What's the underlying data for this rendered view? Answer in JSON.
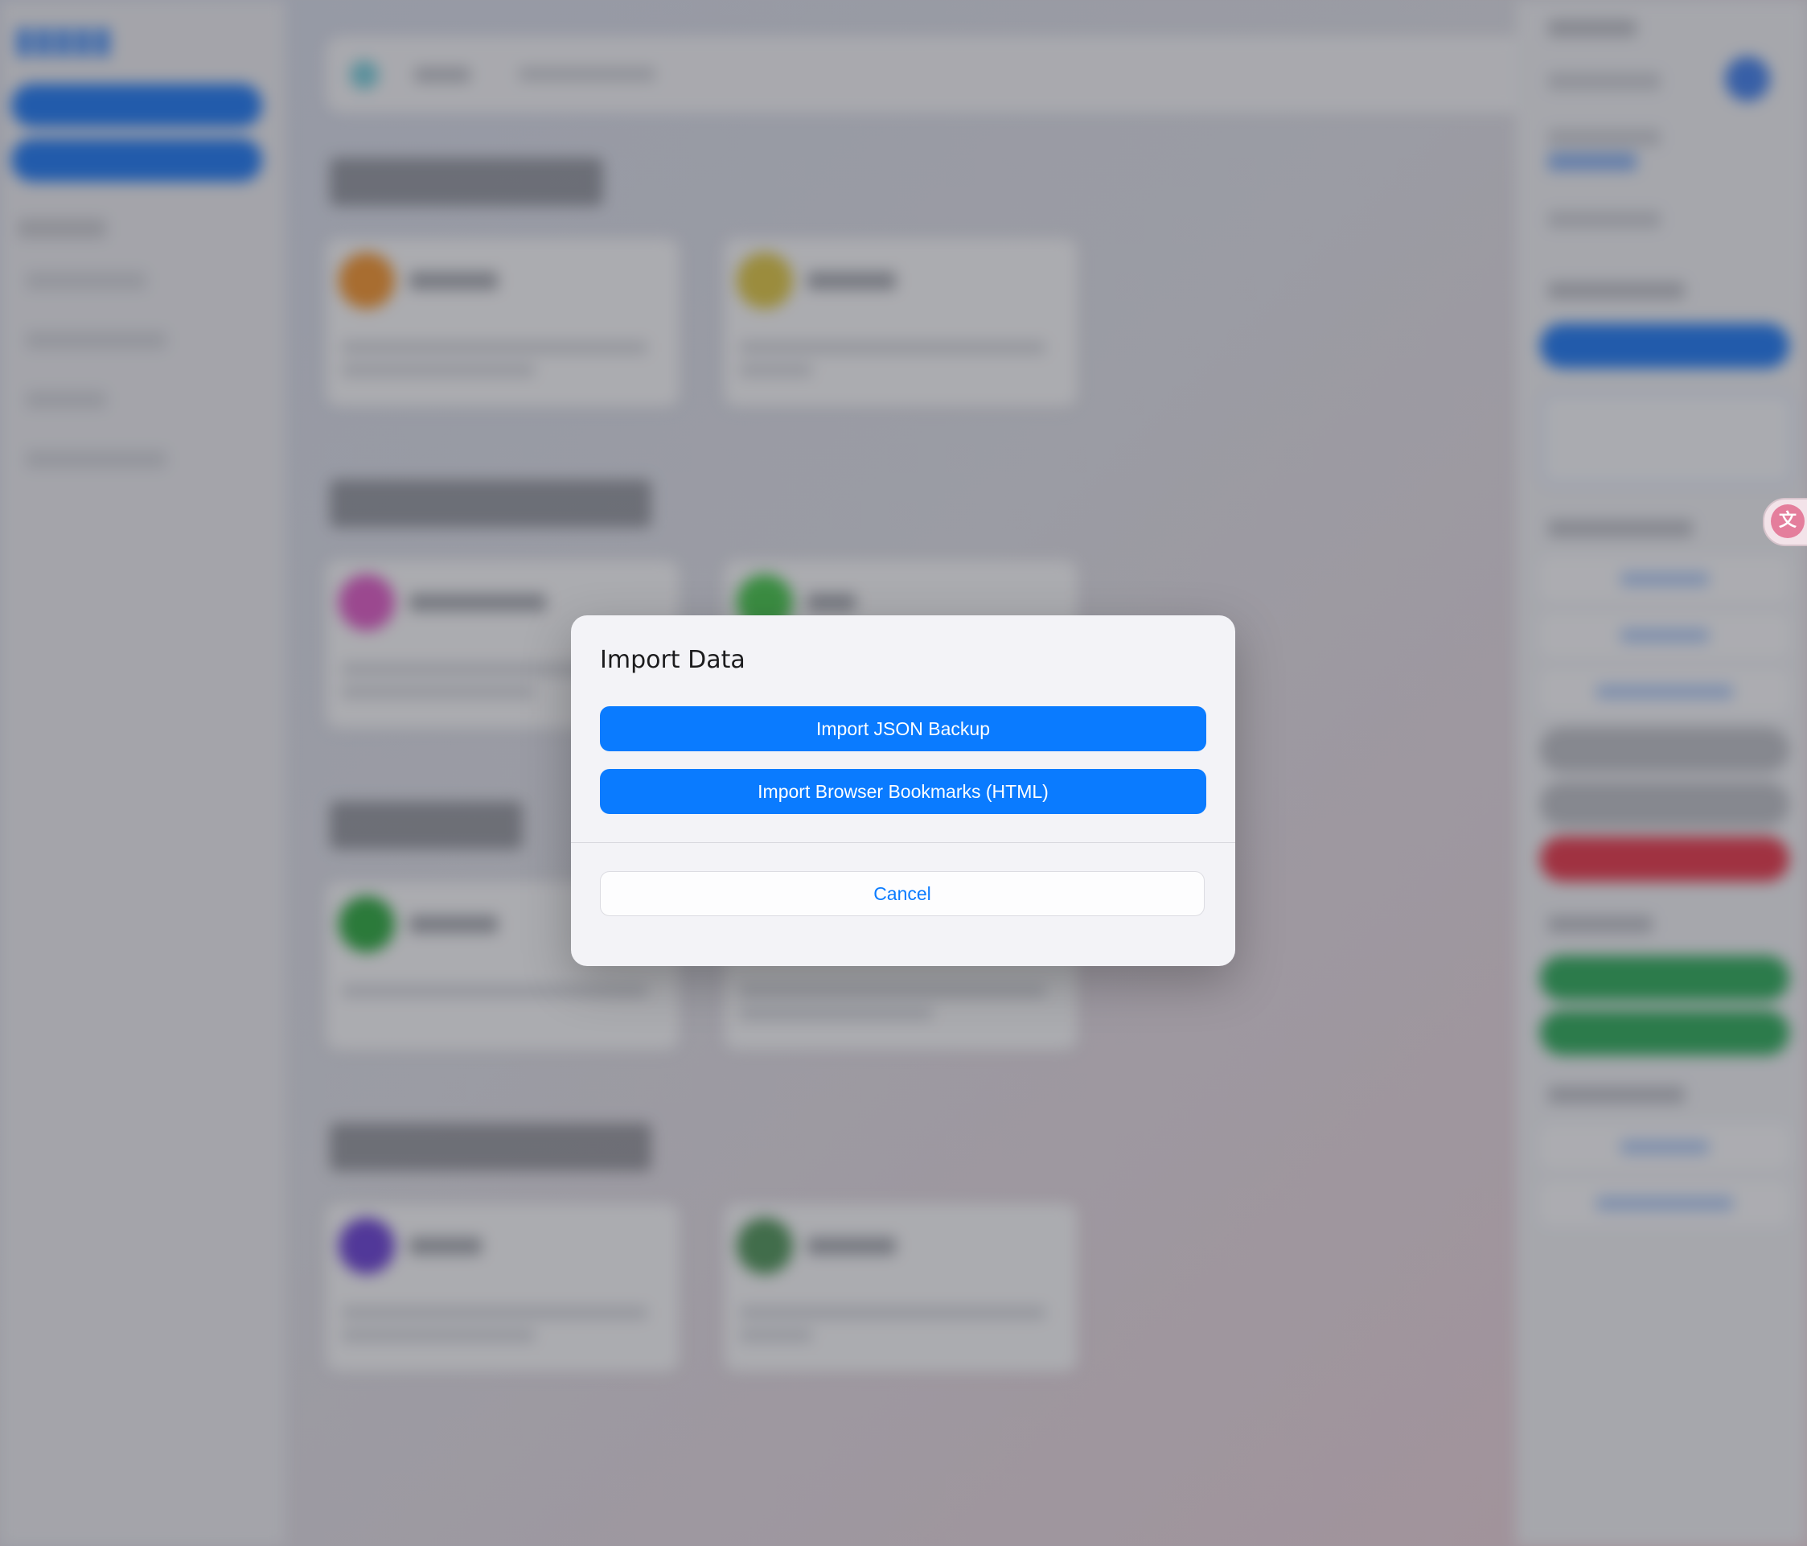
{
  "modal": {
    "title": "Import Data",
    "import_json_label": "Import JSON Backup",
    "import_bookmarks_label": "Import Browser Bookmarks (HTML)",
    "cancel_label": "Cancel"
  },
  "colors": {
    "accent": "#0a7bff",
    "modal_background": "#f3f3f7",
    "overlay": "rgba(70,70,76,0.42)"
  },
  "background_icons": [
    "translate-icon"
  ]
}
